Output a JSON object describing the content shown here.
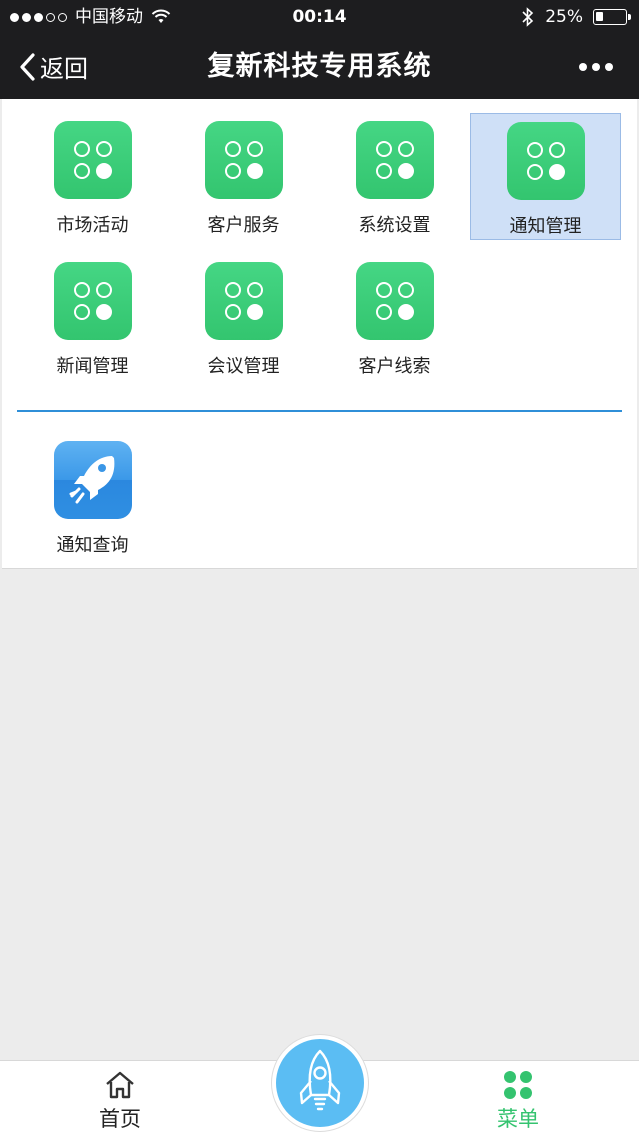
{
  "status_bar": {
    "carrier": "中国移动",
    "time": "00:14",
    "battery": "25%",
    "battery_level": 0.25
  },
  "nav": {
    "back_label": "返回",
    "title": "复新科技专用系统"
  },
  "apps": [
    {
      "label": "市场活动",
      "icon": "app-grid-icon",
      "selected": false
    },
    {
      "label": "客户服务",
      "icon": "app-grid-icon",
      "selected": false
    },
    {
      "label": "系统设置",
      "icon": "app-grid-icon",
      "selected": false
    },
    {
      "label": "通知管理",
      "icon": "app-grid-icon",
      "selected": true
    },
    {
      "label": "新闻管理",
      "icon": "app-grid-icon",
      "selected": false
    },
    {
      "label": "会议管理",
      "icon": "app-grid-icon",
      "selected": false
    },
    {
      "label": "客户线索",
      "icon": "app-grid-icon",
      "selected": false
    }
  ],
  "queries": [
    {
      "label": "通知查询",
      "icon": "rocket-icon"
    }
  ],
  "tabbar": {
    "home_label": "首页",
    "menu_label": "菜单"
  },
  "colors": {
    "nav_bg": "#1d1d1f",
    "app_green": "#3ccd78",
    "accent_blue": "#2f8fd8",
    "selected_bg": "#cfe0f7",
    "menu_active": "#34c36f",
    "fab_blue": "#5bbdf3"
  }
}
